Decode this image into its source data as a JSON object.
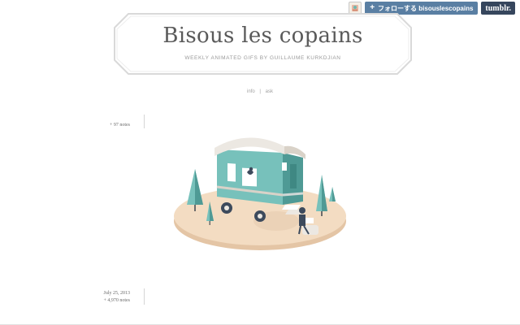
{
  "tumblr_bar": {
    "follow_label": "フォローする bisouslescopains",
    "plus": "+",
    "logo": "tumblr."
  },
  "site": {
    "title": "Bisous les copains",
    "subtitle": "WEEKLY ANIMATED GIFS BY GUILLAUME KURKDJIAN"
  },
  "nav": {
    "info": "info",
    "separator": "|",
    "ask": "ask"
  },
  "posts": [
    {
      "date": "",
      "notes": "+ 97 notes"
    },
    {
      "date": "July 25, 2013",
      "notes": "+ 4,970 notes"
    }
  ],
  "colors": {
    "header_border": "#d9d9d9",
    "title": "#5a5a5a",
    "teal_dark": "#4f9a95",
    "teal_light": "#77c1bb",
    "ground": "#f3dcc2",
    "ground_edge": "#e4c5a5",
    "caravan_roof": "#ece8e2"
  }
}
